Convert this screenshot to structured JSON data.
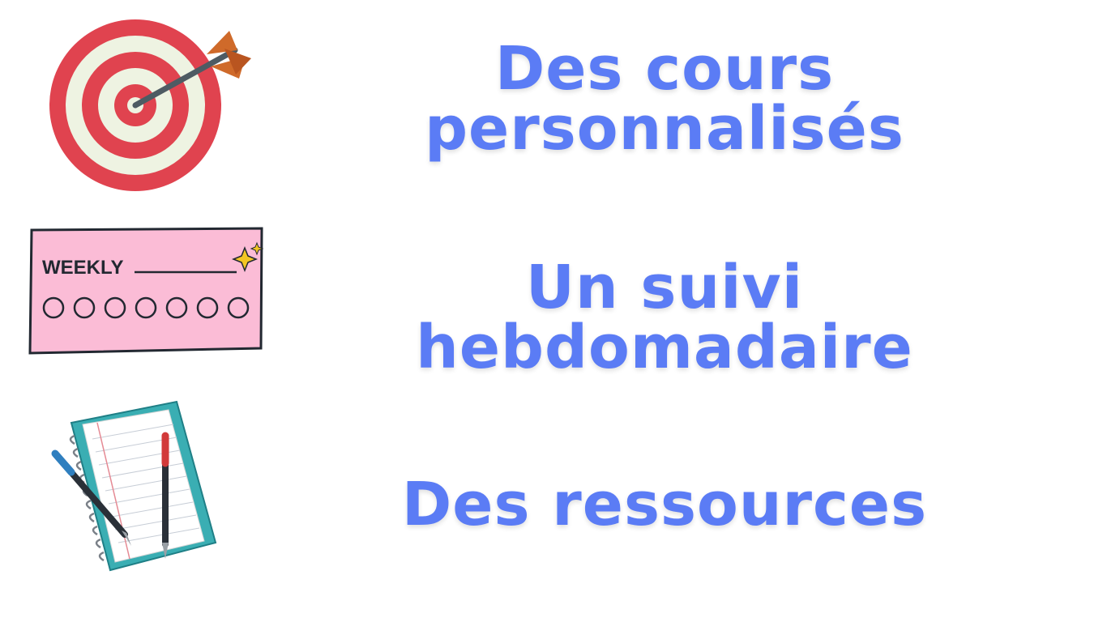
{
  "colors": {
    "accent": "#5b7cf5",
    "target_red": "#e0434f",
    "target_cream": "#eef3e2",
    "arrow_orange": "#cf6a2a",
    "weekly_pink": "#fbbcd6",
    "notebook_teal": "#3aaeb3"
  },
  "features": [
    {
      "icon": "target-icon",
      "lines": [
        "Des cours",
        "personnalisés"
      ]
    },
    {
      "icon": "weekly-planner-icon",
      "lines": [
        "Un suivi",
        "hebdomadaire"
      ],
      "icon_text": "WEEKLY"
    },
    {
      "icon": "notebook-pens-icon",
      "lines": [
        "Des ressources"
      ]
    }
  ]
}
